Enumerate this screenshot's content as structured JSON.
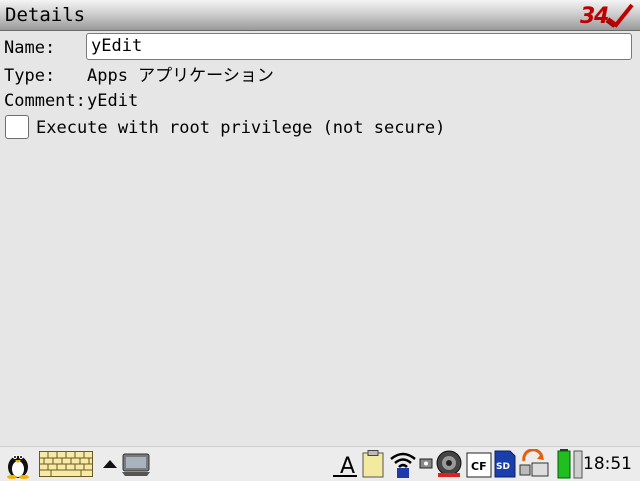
{
  "window": {
    "title": "Details"
  },
  "form": {
    "name_label": "Name:",
    "name_value": "yEdit",
    "type_label": "Type:",
    "type_value": "Apps アプリケーション",
    "comment_label": "Comment:",
    "comment_value": "yEdit",
    "root_checkbox_label": "Execute with root privilege (not secure)",
    "root_checked": false
  },
  "taskbar": {
    "clock": "18:51",
    "cf_label": "CF",
    "sd_label": "SD",
    "font_label": "A"
  },
  "icons": [
    "tux-icon",
    "keyboard-icon",
    "up-arrow-icon",
    "screen-icon",
    "font-icon",
    "clipboard-icon",
    "wireless-icon",
    "alarm-icon",
    "speaker-icon",
    "cf-card-icon",
    "sd-card-icon",
    "sync-icon",
    "battery-icon"
  ],
  "colors": {
    "battery": "#1fbf1f",
    "logo": "#c00000"
  }
}
